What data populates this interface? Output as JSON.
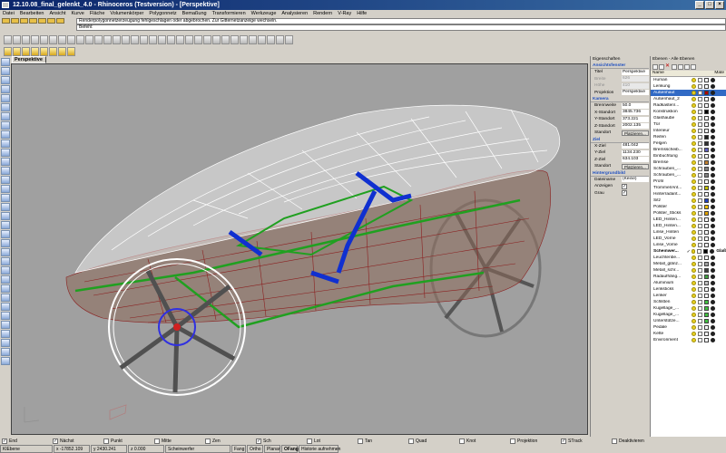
{
  "window": {
    "title": "12.10.08_final_gelenkt_4.0 - Rhinoceros (Testversion) - [Perspektive]"
  },
  "menu": [
    "Datei",
    "Bearbeiten",
    "Ansicht",
    "Kurve",
    "Fläche",
    "Volumenkörper",
    "Polygonnetz",
    "Bemaßung",
    "Transformieren",
    "Werkzeuge",
    "Analysieren",
    "Rendern",
    "V-Ray",
    "Hilfe"
  ],
  "command": {
    "history": "Renderpolygonnetzerzeugung fehlgeschlagen oder abgebrochen. Zur Gitternetzanzeige wechseln.",
    "prompt": "Befehl:"
  },
  "viewport": {
    "tab": "Perspektive"
  },
  "properties": {
    "title": "Eigenschaften",
    "viewport_section": "Ansichtsfenster",
    "rows": [
      {
        "key": "Titel",
        "value": "Perspektive",
        "dim": false
      },
      {
        "key": "Breite",
        "value": "626",
        "dim": true
      },
      {
        "key": "Höhe",
        "value": "410",
        "dim": true
      },
      {
        "key": "Projektion",
        "value": "Perspektive",
        "dim": false
      }
    ],
    "camera_section": "Kamera",
    "camera_rows": [
      {
        "key": "Brennweite",
        "value": "50.0"
      },
      {
        "key": "X-Standort",
        "value": "3845.736"
      },
      {
        "key": "Y-Standort",
        "value": "373.221"
      },
      {
        "key": "Z-Standort",
        "value": "2002.135"
      }
    ],
    "camera_button_label": "Standort",
    "place_button": "Platzieren...",
    "target_section": "Ziel",
    "target_rows": [
      {
        "key": "X-Ziel",
        "value": "481.042"
      },
      {
        "key": "Y-Ziel",
        "value": "1134.230"
      },
      {
        "key": "Z-Ziel",
        "value": "634.103"
      }
    ],
    "target_button_label": "Standort",
    "bg_section": "Hintergrundbild",
    "bg_rows": [
      {
        "key": "Dateiname",
        "value": "(Keine)"
      },
      {
        "key": "Anzeigen",
        "value": "✓"
      },
      {
        "key": "Grau",
        "value": "✓"
      }
    ]
  },
  "layers": {
    "title": "Ebenen - Alle Ebenen",
    "col_name": "Name",
    "col_material": "Mate",
    "items": [
      {
        "name": "Human",
        "color": "#ffffff"
      },
      {
        "name": "Lenkung",
        "color": "#ffffff"
      },
      {
        "name": "Außenhaut",
        "color": "#b00000",
        "selected": true
      },
      {
        "name": "Außenhaut_2",
        "color": "#ffffff"
      },
      {
        "name": "Radkasten/...",
        "color": "#ffffff"
      },
      {
        "name": "Konstruktion",
        "color": "#000000"
      },
      {
        "name": "Glashaube",
        "color": "#ffffff"
      },
      {
        "name": "Tür",
        "color": "#ffffff"
      },
      {
        "name": "Interieur",
        "color": "#ffffff"
      },
      {
        "name": "Reifen",
        "color": "#202020"
      },
      {
        "name": "Felgen",
        "color": "#303030"
      },
      {
        "name": "Bremsscheib...",
        "color": "#6060c0"
      },
      {
        "name": "Einbuchtung",
        "color": "#ffffff"
      },
      {
        "name": "Bremse",
        "color": "#c08030"
      },
      {
        "name": "Schrauben_...",
        "color": "#808080"
      },
      {
        "name": "Schrauben_...",
        "color": "#808080"
      },
      {
        "name": "Profil",
        "color": "#ffffff"
      },
      {
        "name": "Trommel/Ant...",
        "color": "#c0c000"
      },
      {
        "name": "Hinterradant...",
        "color": "#ffffff"
      },
      {
        "name": "Sitz",
        "color": "#2040c0"
      },
      {
        "name": "Polster",
        "color": "#f0c000"
      },
      {
        "name": "Polster_Sticks",
        "color": "#e0a000"
      },
      {
        "name": "LED_Hinten...",
        "color": "#ffffff"
      },
      {
        "name": "LED_Hinten...",
        "color": "#ffffff"
      },
      {
        "name": "Linse_Hinten",
        "color": "#ffffff"
      },
      {
        "name": "LED_Vorne",
        "color": "#ffffff"
      },
      {
        "name": "Linse_Vorne",
        "color": "#ffffff"
      },
      {
        "name": "Scheinwer...",
        "color": "#000000",
        "bold": true,
        "current": true
      },
      {
        "name": "Leuchtenbe...",
        "color": "#ffffff"
      },
      {
        "name": "Metall_glänz...",
        "color": "#a0a0a0"
      },
      {
        "name": "Metall_schr...",
        "color": "#404040"
      },
      {
        "name": "Radaufhäng...",
        "color": "#40a040"
      },
      {
        "name": "Aluminium",
        "color": "#c0c0c0"
      },
      {
        "name": "Lenksticks",
        "color": "#ffffff"
      },
      {
        "name": "Lenker",
        "color": "#ffffff"
      },
      {
        "name": "Schlitten",
        "color": "#40c040"
      },
      {
        "name": "Kugellage_...",
        "color": "#40c040"
      },
      {
        "name": "Kugellage_...",
        "color": "#40c040"
      },
      {
        "name": "Unterstütze...",
        "color": "#40c040"
      },
      {
        "name": "Pedale",
        "color": "#ffffff"
      },
      {
        "name": "Kette",
        "color": "#ffffff"
      },
      {
        "name": "Environment",
        "color": "#ffffff"
      }
    ],
    "current_material": "Glaß"
  },
  "osnap": [
    {
      "label": "End",
      "checked": true
    },
    {
      "label": "Nächst",
      "checked": true
    },
    {
      "label": "Punkt",
      "checked": false
    },
    {
      "label": "Mitte",
      "checked": false
    },
    {
      "label": "Zen",
      "checked": false
    },
    {
      "label": "Sch",
      "checked": true
    },
    {
      "label": "Lot",
      "checked": false
    },
    {
      "label": "Tan",
      "checked": false
    },
    {
      "label": "Quad",
      "checked": false
    },
    {
      "label": "Knot",
      "checked": false
    },
    {
      "label": "Projektion",
      "checked": false
    },
    {
      "label": "STrack",
      "checked": true
    },
    {
      "label": "Deaktivieren",
      "checked": false
    }
  ],
  "status": {
    "ebene": "KlEbene",
    "x": "x -17852.109",
    "y": "y 2430.241",
    "z": "z 0.000",
    "layer": "Scheinwerfer",
    "fang": "Fang",
    "ortho": "Ortho",
    "planar": "Planar",
    "ofang": "OFang",
    "history": "Historie aufnehmen"
  }
}
